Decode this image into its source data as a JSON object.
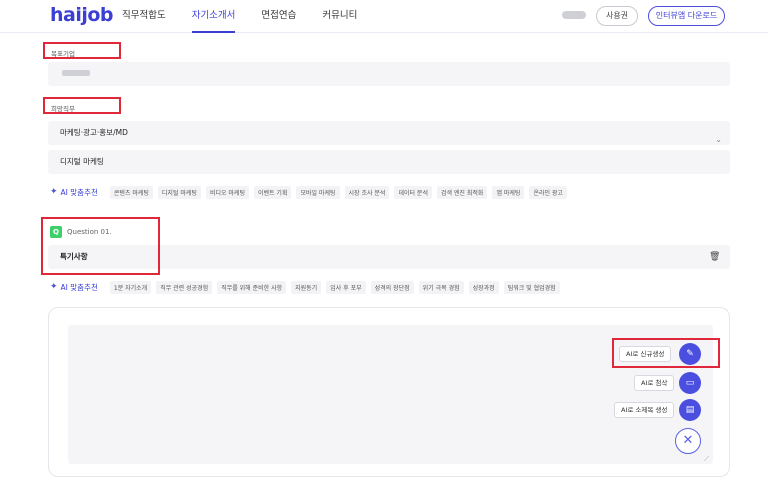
{
  "header": {
    "logo": "haijob",
    "nav": [
      "직무적합도",
      "자기소개서",
      "면접연습",
      "커뮤니티"
    ],
    "coupon_label": "사용권",
    "download_label": "인터뷰앱 다운로드"
  },
  "form": {
    "company_label": "목표기업",
    "job_label": "희망직무",
    "job_category": "마케팅·광고·홍보/MD",
    "job_detail": "디지털 마케팅",
    "ai_label": "AI 맞춤추천",
    "job_chips": [
      "콘텐츠 마케팅",
      "디지털 마케팅",
      "비디오 마케팅",
      "이벤트 기획",
      "모바일 마케팅",
      "시장 조사 분석",
      "데이터 분석",
      "검색 엔진 최적화",
      "앱 마케팅",
      "온라인 광고"
    ]
  },
  "question": {
    "badge": "Q",
    "title": "Question 01.",
    "subject": "특기사항",
    "ai_label": "AI 맞춤추천",
    "chips": [
      "1분 자기소개",
      "직무 관련 성공경험",
      "직무를 위해 준비한 사항",
      "지원동기",
      "입사 후 포부",
      "성격의 장단점",
      "위기 극복 경험",
      "성장과정",
      "팀워크 및 협업경험"
    ]
  },
  "fab": {
    "new_label": "AI로 신규생성",
    "edit_label": "AI로 첨삭",
    "subtitle_label": "AI로 소제목 생성"
  }
}
